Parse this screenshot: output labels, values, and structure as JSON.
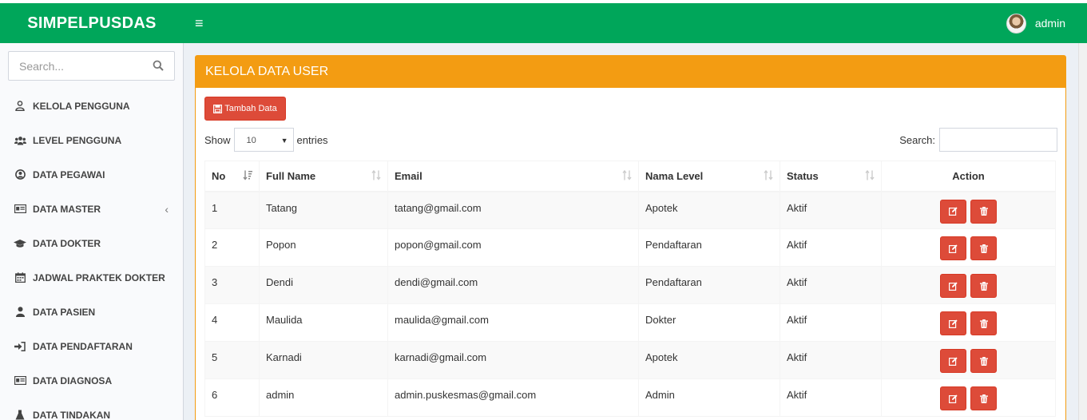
{
  "app": {
    "title": "SIMPELPUSDAS",
    "user": "admin"
  },
  "sidebar": {
    "search_placeholder": "Search...",
    "items": [
      {
        "label": "KELOLA PENGGUNA",
        "icon": "user-outline-icon"
      },
      {
        "label": "LEVEL PENGGUNA",
        "icon": "users-icon"
      },
      {
        "label": "DATA PEGAWAI",
        "icon": "user-circle-icon"
      },
      {
        "label": "DATA MASTER",
        "icon": "id-card-icon"
      },
      {
        "label": "DATA DOKTER",
        "icon": "graduation-cap-icon"
      },
      {
        "label": "JADWAL PRAKTEK DOKTER",
        "icon": "calendar-icon"
      },
      {
        "label": "DATA PASIEN",
        "icon": "user-icon"
      },
      {
        "label": "DATA PENDAFTARAN",
        "icon": "sign-in-icon"
      },
      {
        "label": "DATA DIAGNOSA",
        "icon": "id-card-icon"
      },
      {
        "label": "DATA TINDAKAN",
        "icon": "flask-icon"
      }
    ]
  },
  "panel": {
    "title": "KELOLA DATA USER",
    "add_button": "Tambah Data",
    "show_label": "Show",
    "entries_value": "10",
    "entries_label": "entries",
    "search_label": "Search:"
  },
  "table": {
    "headers": [
      "No",
      "Full Name",
      "Email",
      "Nama Level",
      "Status",
      "Action"
    ],
    "rows": [
      [
        "1",
        "Tatang",
        "tatang@gmail.com",
        "Apotek",
        "Aktif"
      ],
      [
        "2",
        "Popon",
        "popon@gmail.com",
        "Pendaftaran",
        "Aktif"
      ],
      [
        "3",
        "Dendi",
        "dendi@gmail.com",
        "Pendaftaran",
        "Aktif"
      ],
      [
        "4",
        "Maulida",
        "maulida@gmail.com",
        "Dokter",
        "Aktif"
      ],
      [
        "5",
        "Karnadi",
        "karnadi@gmail.com",
        "Apotek",
        "Aktif"
      ],
      [
        "6",
        "admin",
        "admin.puskesmas@gmail.com",
        "Admin",
        "Aktif"
      ]
    ]
  },
  "colors": {
    "header": "#00a65a",
    "panel": "#f39c12",
    "danger": "#dd4b39"
  }
}
